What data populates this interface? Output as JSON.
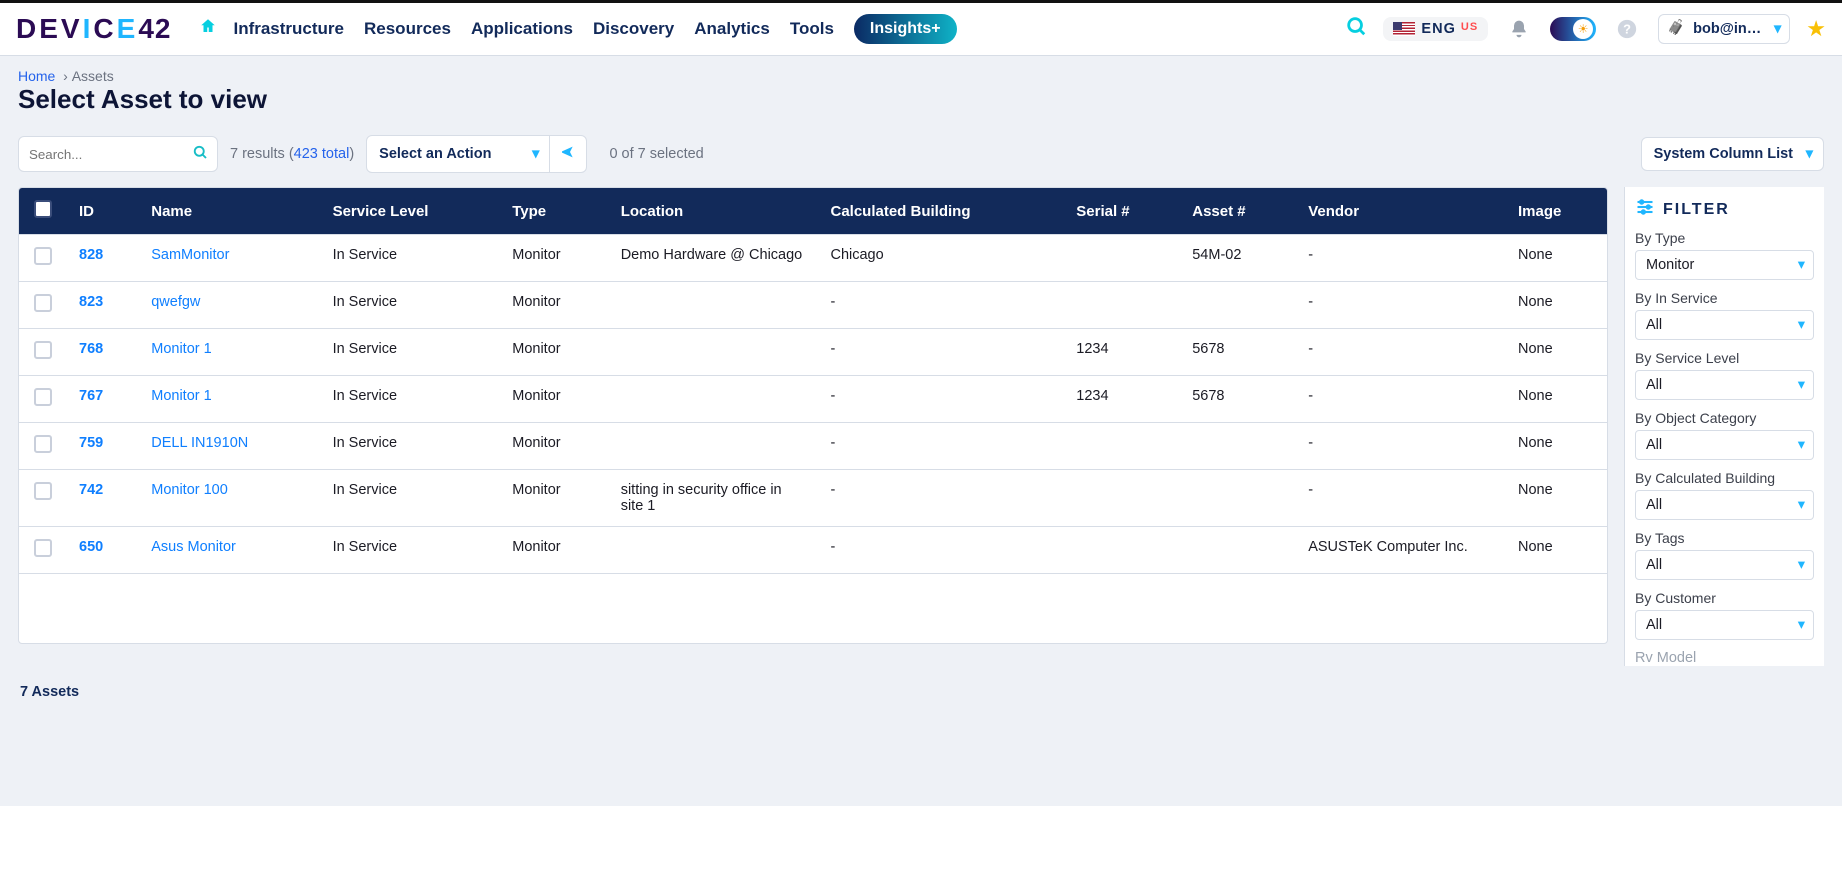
{
  "nav": {
    "items": [
      "Infrastructure",
      "Resources",
      "Applications",
      "Discovery",
      "Analytics",
      "Tools"
    ],
    "insights": "Insights+"
  },
  "header": {
    "lang": "ENG",
    "lang_sub": "US",
    "user": "bob@in…"
  },
  "crumbs": {
    "home": "Home",
    "current": "Assets"
  },
  "page_title": "Select Asset to view",
  "toolbar": {
    "search_placeholder": "Search...",
    "results_prefix": "7 results (",
    "results_total": "423 total",
    "results_suffix": ")",
    "action_label": "Select an Action",
    "selection": "0 of 7 selected",
    "column_list": "System Column List"
  },
  "table": {
    "headers": [
      "ID",
      "Name",
      "Service Level",
      "Type",
      "Location",
      "Calculated Building",
      "Serial #",
      "Asset #",
      "Vendor",
      "Image"
    ],
    "rows": [
      {
        "id": "828",
        "name": "SamMonitor",
        "service": "In Service",
        "type": "Monitor",
        "location": "Demo Hardware @ Chicago",
        "building": "Chicago",
        "serial": "",
        "asset": "54M-02",
        "vendor": "-",
        "image": "None"
      },
      {
        "id": "823",
        "name": "qwefgw",
        "service": "In Service",
        "type": "Monitor",
        "location": "",
        "building": "-",
        "serial": "",
        "asset": "",
        "vendor": "-",
        "image": "None"
      },
      {
        "id": "768",
        "name": "Monitor 1",
        "service": "In Service",
        "type": "Monitor",
        "location": "",
        "building": "-",
        "serial": "1234",
        "asset": "5678",
        "vendor": "-",
        "image": "None"
      },
      {
        "id": "767",
        "name": "Monitor 1",
        "service": "In Service",
        "type": "Monitor",
        "location": "",
        "building": "-",
        "serial": "1234",
        "asset": "5678",
        "vendor": "-",
        "image": "None"
      },
      {
        "id": "759",
        "name": "DELL IN1910N",
        "service": "In Service",
        "type": "Monitor",
        "location": "",
        "building": "-",
        "serial": "",
        "asset": "",
        "vendor": "-",
        "image": "None"
      },
      {
        "id": "742",
        "name": "Monitor 100",
        "service": "In Service",
        "type": "Monitor",
        "location": "sitting in security office in site 1",
        "building": "-",
        "serial": "",
        "asset": "",
        "vendor": "-",
        "image": "None"
      },
      {
        "id": "650",
        "name": "Asus Monitor",
        "service": "In Service",
        "type": "Monitor",
        "location": "",
        "building": "-",
        "serial": "",
        "asset": "",
        "vendor": "ASUSTeK Computer Inc.",
        "image": "None"
      }
    ]
  },
  "filter": {
    "title": "FILTER",
    "groups": [
      {
        "label": "By Type",
        "value": "Monitor"
      },
      {
        "label": "By In Service",
        "value": "All"
      },
      {
        "label": "By Service Level",
        "value": "All"
      },
      {
        "label": "By Object Category",
        "value": "All"
      },
      {
        "label": "By Calculated Building",
        "value": "All"
      },
      {
        "label": "By Tags",
        "value": "All"
      },
      {
        "label": "By Customer",
        "value": "All"
      }
    ],
    "truncated_label": "Rv Model"
  },
  "footer": {
    "count": "7 Assets"
  }
}
